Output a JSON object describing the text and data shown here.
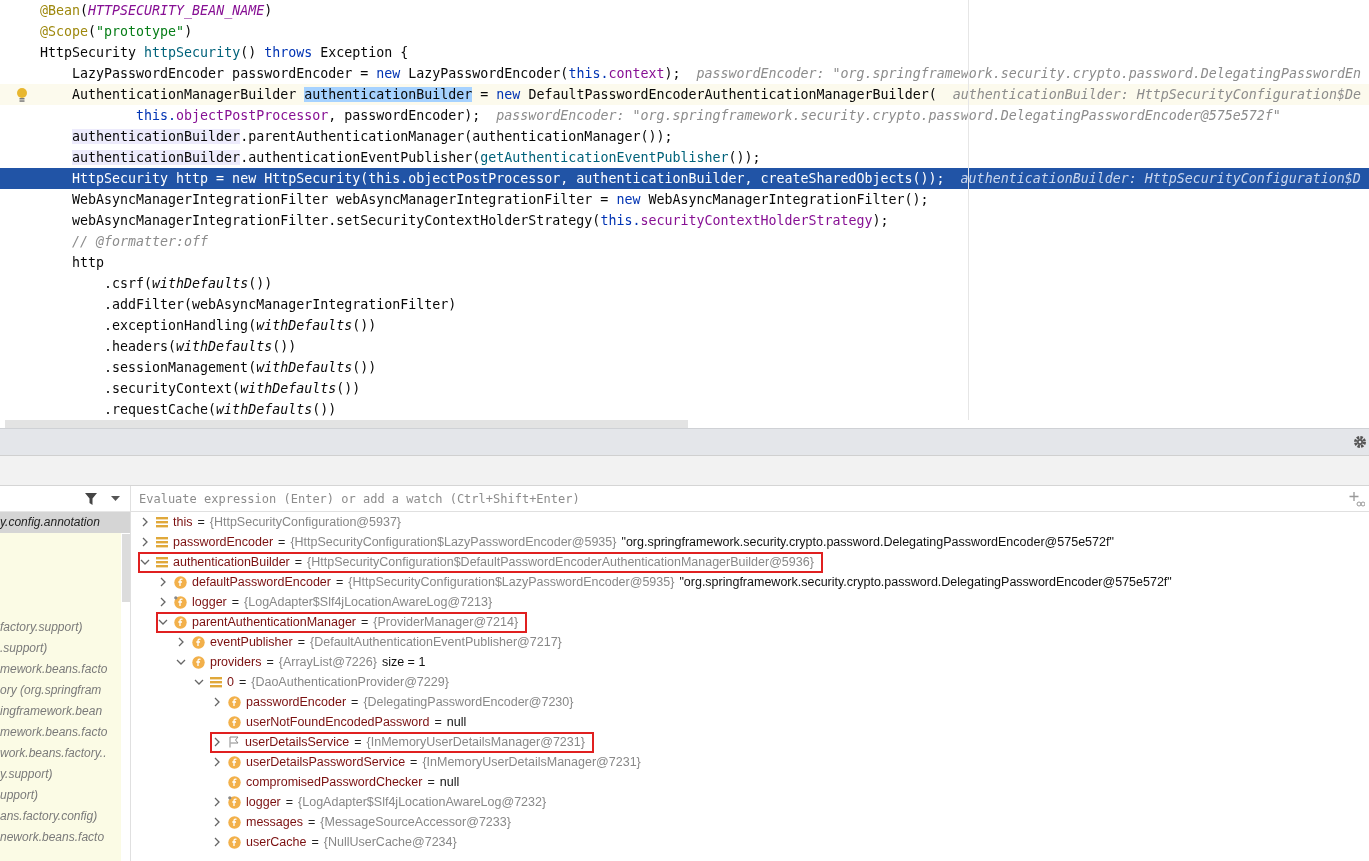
{
  "editor": {
    "lines": [
      {
        "kind": "statement",
        "selected": false,
        "current": false,
        "bulb": false,
        "tokens": [
          {
            "kind": "ann",
            "t": "@Bean"
          },
          {
            "kind": "p",
            "t": "("
          },
          {
            "kind": "sit",
            "t": "HTTPSECURITY_BEAN_NAME"
          },
          {
            "kind": "p",
            "t": ")"
          }
        ]
      },
      {
        "kind": "statement",
        "selected": false,
        "current": false,
        "bulb": false,
        "tokens": [
          {
            "kind": "ann",
            "t": "@Scope"
          },
          {
            "kind": "p",
            "t": "("
          },
          {
            "kind": "str",
            "t": "\"prototype\""
          },
          {
            "kind": "p",
            "t": ")"
          }
        ]
      },
      {
        "kind": "statement",
        "selected": false,
        "current": false,
        "bulb": false,
        "tokens": [
          {
            "kind": "p",
            "t": "HttpSecurity "
          },
          {
            "kind": "fn",
            "t": "httpSecurity"
          },
          {
            "kind": "p",
            "t": "() "
          },
          {
            "kind": "kw",
            "t": "throws"
          },
          {
            "kind": "p",
            "t": " Exception {"
          }
        ],
        "children": [
          {
            "kind": "statement",
            "selected": false,
            "current": false,
            "bulb": false,
            "tokens": [
              {
                "kind": "p",
                "t": "LazyPasswordEncoder passwordEncoder = "
              },
              {
                "kind": "kw",
                "t": "new"
              },
              {
                "kind": "p",
                "t": " LazyPasswordEncoder("
              },
              {
                "kind": "kw",
                "t": "this."
              },
              {
                "kind": "fld",
                "t": "context"
              },
              {
                "kind": "p",
                "t": ");"
              },
              {
                "kind": "hint",
                "t": "passwordEncoder: \"org.springframework.security.crypto.password.DelegatingPasswordEn"
              }
            ]
          },
          {
            "kind": "statement",
            "selected": false,
            "current": true,
            "bulb": true,
            "tokens": [
              {
                "kind": "p",
                "t": "AuthenticationManagerBuilder "
              },
              {
                "kind": "hl",
                "t": "authenticationBuilder"
              },
              {
                "kind": "p",
                "t": " = "
              },
              {
                "kind": "kw",
                "t": "new"
              },
              {
                "kind": "p",
                "t": " DefaultPasswordEncoderAuthenticationManagerBuilder("
              },
              {
                "kind": "hint",
                "t": "authenticationBuilder: HttpSecurityConfiguration$De"
              }
            ],
            "children": [
              {
                "kind": "continuation",
                "selected": false,
                "current": false,
                "bulb": false,
                "tokens": [
                  {
                    "kind": "kw",
                    "t": "this."
                  },
                  {
                    "kind": "fld",
                    "t": "objectPostProcessor"
                  },
                  {
                    "kind": "p",
                    "t": ", passwordEncoder);"
                  },
                  {
                    "kind": "hint",
                    "t": "passwordEncoder: \"org.springframework.security.crypto.password.DelegatingPasswordEncoder@575e572f\""
                  }
                ]
              }
            ]
          },
          {
            "kind": "statement",
            "selected": false,
            "current": false,
            "bulb": false,
            "tokens": [
              {
                "kind": "use",
                "t": "authenticationBuilder"
              },
              {
                "kind": "p",
                "t": ".parentAuthenticationManager(authenticationManager());"
              }
            ]
          },
          {
            "kind": "statement",
            "selected": false,
            "current": false,
            "bulb": false,
            "tokens": [
              {
                "kind": "use",
                "t": "authenticationBuilder"
              },
              {
                "kind": "p",
                "t": ".authenticationEventPublisher("
              },
              {
                "kind": "fn",
                "t": "getAuthenticationEventPublisher"
              },
              {
                "kind": "p",
                "t": "());"
              }
            ]
          },
          {
            "kind": "statement",
            "selected": true,
            "current": false,
            "bulb": false,
            "tokens": [
              {
                "kind": "p",
                "t": "HttpSecurity http = new HttpSecurity(this.objectPostProcessor, authenticationBuilder, createSharedObjects());"
              },
              {
                "kind": "hint",
                "t": "authenticationBuilder: HttpSecurityConfiguration$D"
              }
            ]
          },
          {
            "kind": "statement",
            "selected": false,
            "current": false,
            "bulb": false,
            "tokens": [
              {
                "kind": "p",
                "t": "WebAsyncManagerIntegrationFilter webAsyncManagerIntegrationFilter = "
              },
              {
                "kind": "kw",
                "t": "new"
              },
              {
                "kind": "p",
                "t": " WebAsyncManagerIntegrationFilter();"
              }
            ]
          },
          {
            "kind": "statement",
            "selected": false,
            "current": false,
            "bulb": false,
            "tokens": [
              {
                "kind": "p",
                "t": "webAsyncManagerIntegrationFilter.setSecurityContextHolderStrategy("
              },
              {
                "kind": "kw",
                "t": "this."
              },
              {
                "kind": "fld",
                "t": "securityContextHolderStrategy"
              },
              {
                "kind": "p",
                "t": ");"
              }
            ]
          },
          {
            "kind": "statement",
            "selected": false,
            "current": false,
            "bulb": false,
            "tokens": [
              {
                "kind": "cm",
                "t": "// @formatter:off"
              }
            ]
          },
          {
            "kind": "statement",
            "selected": false,
            "current": false,
            "bulb": false,
            "tokens": [
              {
                "kind": "p",
                "t": "http"
              }
            ],
            "children": [
              {
                "kind": "statement",
                "selected": false,
                "current": false,
                "bulb": false,
                "tokens": [
                  {
                    "kind": "p",
                    "t": ".csrf("
                  },
                  {
                    "kind": "it",
                    "t": "withDefaults"
                  },
                  {
                    "kind": "p",
                    "t": "())"
                  }
                ]
              },
              {
                "kind": "statement",
                "selected": false,
                "current": false,
                "bulb": false,
                "tokens": [
                  {
                    "kind": "p",
                    "t": ".addFilter(webAsyncManagerIntegrationFilter)"
                  }
                ]
              },
              {
                "kind": "statement",
                "selected": false,
                "current": false,
                "bulb": false,
                "tokens": [
                  {
                    "kind": "p",
                    "t": ".exceptionHandling("
                  },
                  {
                    "kind": "it",
                    "t": "withDefaults"
                  },
                  {
                    "kind": "p",
                    "t": "())"
                  }
                ]
              },
              {
                "kind": "statement",
                "selected": false,
                "current": false,
                "bulb": false,
                "tokens": [
                  {
                    "kind": "p",
                    "t": ".headers("
                  },
                  {
                    "kind": "it",
                    "t": "withDefaults"
                  },
                  {
                    "kind": "p",
                    "t": "())"
                  }
                ]
              },
              {
                "kind": "statement",
                "selected": false,
                "current": false,
                "bulb": false,
                "tokens": [
                  {
                    "kind": "p",
                    "t": ".sessionManagement("
                  },
                  {
                    "kind": "it",
                    "t": "withDefaults"
                  },
                  {
                    "kind": "p",
                    "t": "())"
                  }
                ]
              },
              {
                "kind": "statement",
                "selected": false,
                "current": false,
                "bulb": false,
                "tokens": [
                  {
                    "kind": "p",
                    "t": ".securityContext("
                  },
                  {
                    "kind": "it",
                    "t": "withDefaults"
                  },
                  {
                    "kind": "p",
                    "t": "())"
                  }
                ]
              },
              {
                "kind": "statement",
                "selected": false,
                "current": false,
                "bulb": false,
                "tokens": [
                  {
                    "kind": "p",
                    "t": ".requestCache("
                  },
                  {
                    "kind": "it",
                    "t": "withDefaults"
                  },
                  {
                    "kind": "p",
                    "t": "())"
                  }
                ]
              }
            ]
          }
        ]
      }
    ]
  },
  "frames": [
    {
      "text": "y.config.annotation",
      "selected": true
    },
    {
      "text": "factory.support)",
      "selected": false
    },
    {
      "text": ".support)",
      "selected": false
    },
    {
      "text": "mework.beans.facto",
      "selected": false
    },
    {
      "text": "ory (org.springfram",
      "selected": false
    },
    {
      "text": "ingframework.bean",
      "selected": false
    },
    {
      "text": "mework.beans.facto",
      "selected": false
    },
    {
      "text": "work.beans.factory..",
      "selected": false
    },
    {
      "text": "y.support)",
      "selected": false
    },
    {
      "text": "upport)",
      "selected": false
    },
    {
      "text": "ans.factory.config)",
      "selected": false
    },
    {
      "text": "nework.beans.facto",
      "selected": false
    }
  ],
  "watch": {
    "placeholder": "Evaluate expression (Enter) or add a watch (Ctrl+Shift+Enter)"
  },
  "variables": [
    {
      "leaf": false,
      "expanded": false,
      "kind": "list",
      "boxed": false,
      "name": "this",
      "op": "=",
      "type": "{HttpSecurityConfiguration@5937}"
    },
    {
      "leaf": false,
      "expanded": false,
      "kind": "list",
      "boxed": false,
      "name": "passwordEncoder",
      "op": "=",
      "type": "{HttpSecurityConfiguration$LazyPasswordEncoder@5935}",
      "value": "\"org.springframework.security.crypto.password.DelegatingPasswordEncoder@575e572f\""
    },
    {
      "leaf": false,
      "expanded": true,
      "kind": "list",
      "boxed": true,
      "name": "authenticationBuilder",
      "op": "=",
      "type": "{HttpSecurityConfiguration$DefaultPasswordEncoderAuthenticationManagerBuilder@5936}",
      "children": [
        {
          "leaf": false,
          "expanded": false,
          "kind": "field",
          "boxed": false,
          "name": "defaultPasswordEncoder",
          "op": "=",
          "type": "{HttpSecurityConfiguration$LazyPasswordEncoder@5935}",
          "value": "\"org.springframework.security.crypto.password.DelegatingPasswordEncoder@575e572f\""
        },
        {
          "leaf": false,
          "expanded": false,
          "kind": "static",
          "boxed": false,
          "name": "logger",
          "op": "=",
          "type": "{LogAdapter$Slf4jLocationAwareLog@7213}"
        },
        {
          "leaf": false,
          "expanded": true,
          "kind": "field",
          "boxed": true,
          "name": "parentAuthenticationManager",
          "op": "=",
          "type": "{ProviderManager@7214}",
          "children": [
            {
              "leaf": false,
              "expanded": false,
              "kind": "field",
              "boxed": false,
              "name": "eventPublisher",
              "op": "=",
              "type": "{DefaultAuthenticationEventPublisher@7217}"
            },
            {
              "leaf": false,
              "expanded": true,
              "kind": "field",
              "boxed": false,
              "name": "providers",
              "op": "=",
              "type": "{ArrayList@7226}",
              "size": "size = 1",
              "children": [
                {
                  "leaf": false,
                  "expanded": true,
                  "kind": "list",
                  "boxed": false,
                  "name": "0",
                  "op": "=",
                  "type": "{DaoAuthenticationProvider@7229}",
                  "children": [
                    {
                      "leaf": false,
                      "expanded": false,
                      "kind": "field",
                      "boxed": false,
                      "name": "passwordEncoder",
                      "op": "=",
                      "type": "{DelegatingPasswordEncoder@7230}"
                    },
                    {
                      "leaf": true,
                      "kind": "field",
                      "boxed": false,
                      "name": "userNotFoundEncodedPassword",
                      "op": "=",
                      "value": "null"
                    },
                    {
                      "leaf": false,
                      "expanded": false,
                      "kind": "flag",
                      "boxed": true,
                      "name": "userDetailsService",
                      "op": "=",
                      "type": "{InMemoryUserDetailsManager@7231}"
                    },
                    {
                      "leaf": false,
                      "expanded": false,
                      "kind": "field",
                      "boxed": false,
                      "name": "userDetailsPasswordService",
                      "op": "=",
                      "type": "{InMemoryUserDetailsManager@7231}"
                    },
                    {
                      "leaf": true,
                      "kind": "field",
                      "boxed": false,
                      "name": "compromisedPasswordChecker",
                      "op": "=",
                      "value": "null"
                    },
                    {
                      "leaf": false,
                      "expanded": false,
                      "kind": "static",
                      "boxed": false,
                      "name": "logger",
                      "op": "=",
                      "type": "{LogAdapter$Slf4jLocationAwareLog@7232}"
                    },
                    {
                      "leaf": false,
                      "expanded": false,
                      "kind": "field",
                      "boxed": false,
                      "name": "messages",
                      "op": "=",
                      "type": "{MessageSourceAccessor@7233}"
                    },
                    {
                      "leaf": false,
                      "expanded": false,
                      "kind": "field",
                      "boxed": false,
                      "name": "userCache",
                      "op": "=",
                      "type": "{NullUserCache@7234}"
                    }
                  ]
                }
              ]
            }
          ]
        }
      ]
    }
  ]
}
